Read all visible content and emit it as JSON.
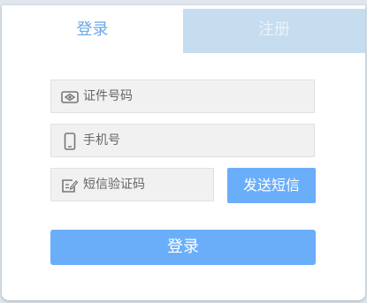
{
  "tabs": {
    "login": "登录",
    "register": "注册"
  },
  "fields": {
    "id_number": {
      "placeholder": "证件号码",
      "icon": "id-card-icon"
    },
    "phone": {
      "placeholder": "手机号",
      "icon": "phone-icon"
    },
    "sms_code": {
      "placeholder": "短信验证码",
      "icon": "edit-code-icon"
    }
  },
  "buttons": {
    "send_sms": "发送短信",
    "submit": "登录"
  },
  "colors": {
    "accent": "#6aaefa",
    "tab_active_text": "#6aa8e6",
    "tab_inactive_bg": "#c6ddf0"
  }
}
